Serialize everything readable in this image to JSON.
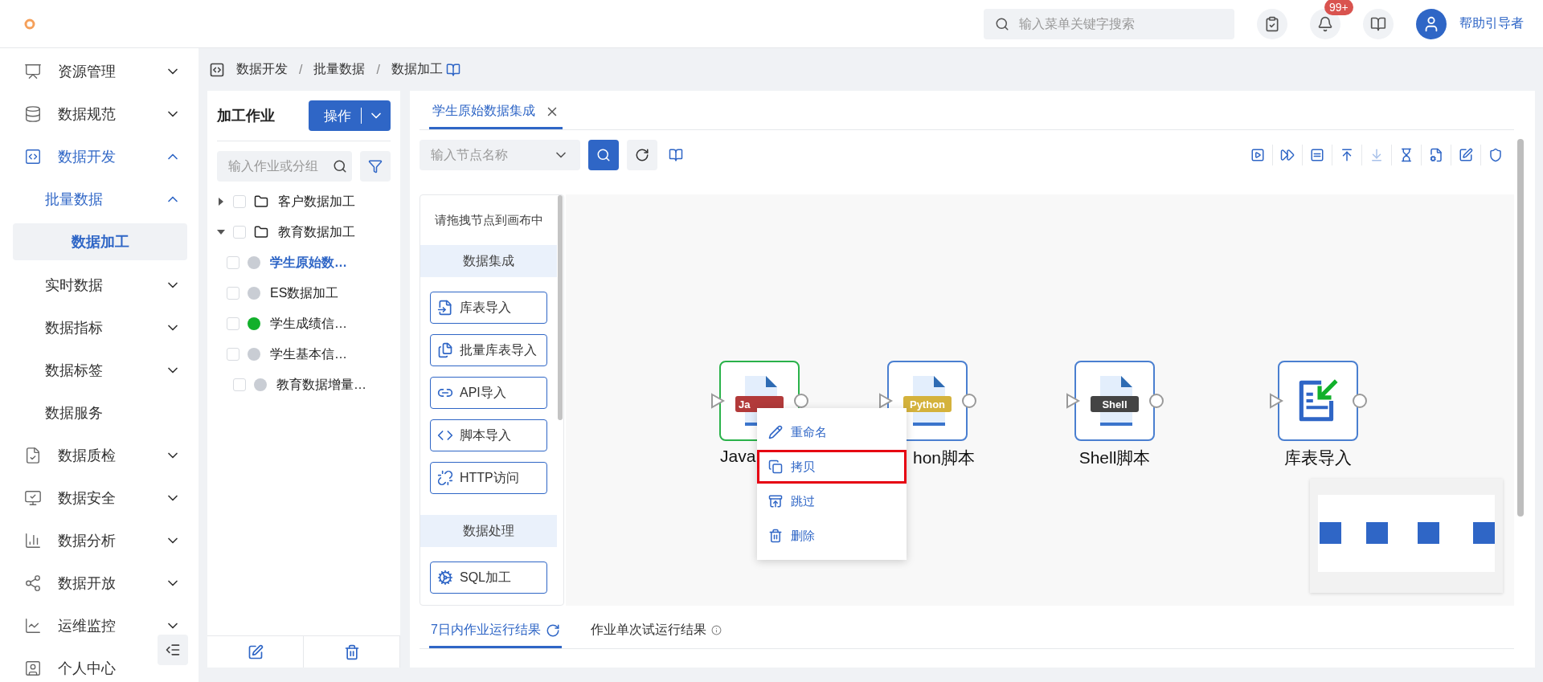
{
  "topbar": {
    "search": {
      "placeholder": "输入菜单关键字搜索"
    },
    "notification_badge": "99+",
    "user": "帮助引导者"
  },
  "sidebar": {
    "items": [
      {
        "label": "资源管理",
        "expanded": false,
        "selected": false
      },
      {
        "label": "数据规范",
        "expanded": false,
        "selected": false
      },
      {
        "label": "数据开发",
        "expanded": true,
        "selected": false,
        "children": [
          {
            "label": "批量数据",
            "expanded": true,
            "selected": false,
            "children": [
              {
                "label": "数据加工",
                "selected": true
              }
            ]
          },
          {
            "label": "实时数据",
            "expanded": false,
            "selected": false
          },
          {
            "label": "数据指标",
            "expanded": false,
            "selected": false
          },
          {
            "label": "数据标签",
            "expanded": false,
            "selected": false
          },
          {
            "label": "数据服务",
            "selected": false
          }
        ]
      },
      {
        "label": "数据质检",
        "expanded": false,
        "selected": false
      },
      {
        "label": "数据安全",
        "expanded": false,
        "selected": false
      },
      {
        "label": "数据分析",
        "expanded": false,
        "selected": false
      },
      {
        "label": "数据开放",
        "expanded": false,
        "selected": false
      },
      {
        "label": "运维监控",
        "expanded": false,
        "selected": false
      },
      {
        "label": "个人中心",
        "selected": false
      }
    ]
  },
  "breadcrumb": [
    {
      "kind": "link",
      "text": "数据开发"
    },
    {
      "kind": "separator",
      "text": "/"
    },
    {
      "kind": "link",
      "text": "批量数据"
    },
    {
      "kind": "separator",
      "text": "/"
    },
    {
      "kind": "current",
      "text": "数据加工"
    }
  ],
  "job_panel": {
    "title": "加工作业",
    "action_button": "操作",
    "search": {
      "placeholder": "输入作业或分组"
    },
    "tree": [
      {
        "kind": "folder",
        "label": "客户数据加工",
        "expanded": false,
        "checked": false,
        "selected": false
      },
      {
        "kind": "folder",
        "label": "教育数据加工",
        "expanded": true,
        "checked": false,
        "selected": false,
        "children": [
          {
            "kind": "job",
            "label": "学生原始数…",
            "checked": false,
            "selected": true,
            "color": "#c9cdd4"
          },
          {
            "kind": "job",
            "label": "ES数据加工",
            "checked": false,
            "selected": false,
            "color": "#c9cdd4"
          },
          {
            "kind": "job",
            "label": "学生成绩信…",
            "checked": false,
            "selected": false,
            "color": "#12b02b"
          },
          {
            "kind": "job",
            "label": "学生基本信…",
            "checked": false,
            "selected": false,
            "color": "#c9cdd4"
          }
        ]
      },
      {
        "kind": "job",
        "label": "教育数据增量…",
        "checked": false,
        "selected": false,
        "color": "#c9cdd4"
      }
    ]
  },
  "editor": {
    "tabs": [
      {
        "label": "学生原始数据集成",
        "selected": true
      }
    ],
    "node_search": {
      "placeholder": "输入节点名称"
    },
    "canvas_tools": [
      {
        "disabled": false
      },
      {
        "disabled": false
      },
      {
        "disabled": false
      },
      {
        "disabled": false
      },
      {
        "disabled": true
      },
      {
        "disabled": false
      },
      {
        "disabled": false
      },
      {
        "disabled": false
      },
      {
        "disabled": false
      }
    ],
    "palette": {
      "hint": "请拖拽节点到画布中",
      "groups": [
        {
          "title": "数据集成",
          "items": [
            "库表导入",
            "批量库表导入",
            "API导入",
            "脚本导入",
            "HTTP访问"
          ]
        },
        {
          "title": "数据处理",
          "items": [
            "SQL加工"
          ]
        }
      ]
    },
    "nodes": [
      {
        "kind": "file",
        "badge": "Ja",
        "color": "#b23a3a",
        "label": "Java",
        "selected": true
      },
      {
        "kind": "file",
        "badge": "Python",
        "color": "#d4b23c",
        "label": "hon脚本",
        "selected": false
      },
      {
        "kind": "file",
        "badge": "Shell",
        "color": "#444444",
        "label": "Shell脚本",
        "selected": false
      },
      {
        "kind": "import",
        "label": "库表导入",
        "selected": false
      }
    ],
    "context_menu": [
      {
        "label": "重命名",
        "selected": false
      },
      {
        "label": "拷贝",
        "selected": true
      },
      {
        "label": "跳过",
        "selected": false
      },
      {
        "label": "删除",
        "selected": false
      }
    ]
  },
  "result_tabs": [
    {
      "label": "7日内作业运行结果",
      "selected": true
    },
    {
      "label": "作业单次试运行结果",
      "selected": false
    }
  ]
}
